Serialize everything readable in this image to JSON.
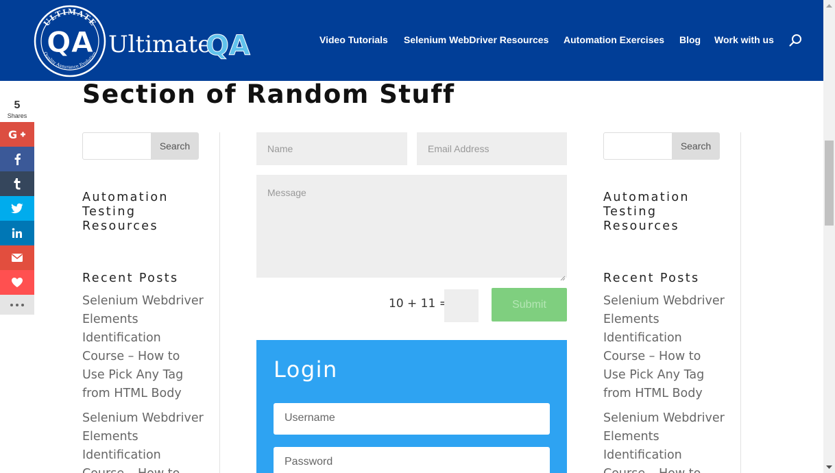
{
  "header": {
    "brand_name_a": "Ultimate",
    "brand_name_b": "QA",
    "logo_ring_text": "ULTIMATE",
    "logo_mark": "QA",
    "logo_tagline": "Quality Assurance Evolution",
    "nav": [
      {
        "label": "Video Tutorials"
      },
      {
        "label": "Selenium WebDriver Resources"
      },
      {
        "label": "Automation Exercises"
      },
      {
        "label": "Blog"
      },
      {
        "label": "Work with us"
      }
    ],
    "search_icon": "search-icon"
  },
  "page": {
    "title": "Section of Random Stuff"
  },
  "share": {
    "count": "5",
    "label": "Shares",
    "buttons": [
      {
        "name": "google-plus-icon",
        "color": "#dc4e41"
      },
      {
        "name": "facebook-icon",
        "color": "#3b5998"
      },
      {
        "name": "tumblr-icon",
        "color": "#35465c"
      },
      {
        "name": "twitter-icon",
        "color": "#00aced"
      },
      {
        "name": "linkedin-icon",
        "color": "#0077b5"
      },
      {
        "name": "email-icon",
        "color": "#e24e3e"
      },
      {
        "name": "heart-icon",
        "color": "#ff5050"
      },
      {
        "name": "more-icon",
        "color": "#e5e5e5"
      }
    ]
  },
  "left_sidebar": {
    "search_button": "Search",
    "widget_title": "Automation Testing Resources",
    "widget_title_lines": [
      "Automation",
      "Testing",
      "Resources"
    ],
    "recent_posts_title": "Recent Posts",
    "posts": [
      "Selenium Webdriver Elements Identification Course – How to Use Pick Any Tag from HTML Body",
      "Selenium Webdriver Elements Identification Course – How to"
    ]
  },
  "right_sidebar": {
    "search_button": "Search",
    "widget_title_lines": [
      "Automation",
      "Testing",
      "Resources"
    ],
    "recent_posts_title": "Recent Posts",
    "posts": [
      "Selenium Webdriver Elements Identification Course – How to Use Pick Any Tag from HTML Body",
      "Selenium Webdriver Elements Identification Course – How to"
    ]
  },
  "contact_form": {
    "name_placeholder": "Name",
    "email_placeholder": "Email Address",
    "message_placeholder": "Message",
    "captcha_question": "10 + 11 =",
    "submit_label": "Submit"
  },
  "login": {
    "title": "Login",
    "username_placeholder": "Username",
    "password_placeholder": "Password"
  },
  "colors": {
    "header_bg": "#013e97",
    "accent_blue": "#2ea3f2",
    "submit_green": "#7fcf7f",
    "field_gray": "#eeeeee"
  }
}
